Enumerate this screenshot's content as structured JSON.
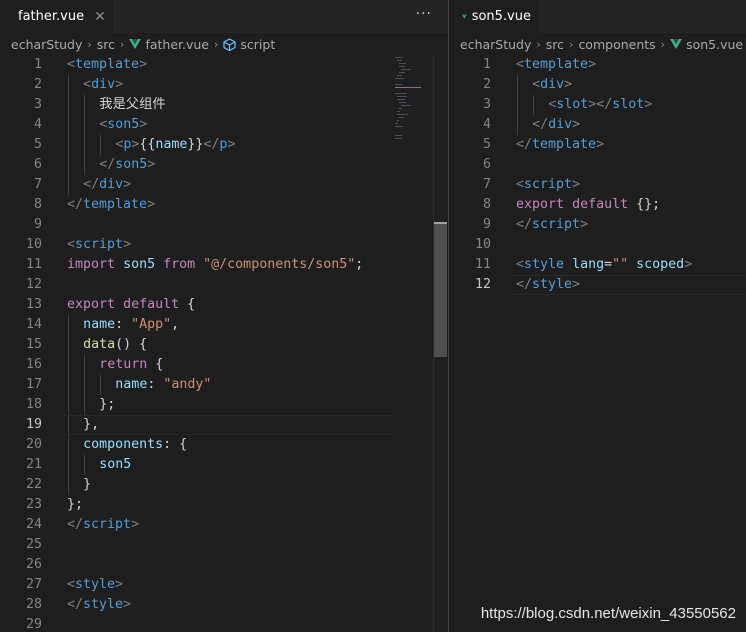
{
  "left_pane": {
    "tab": {
      "label": "father.vue",
      "close": "✕"
    },
    "more": "···",
    "breadcrumb": [
      "echarStudy",
      "src",
      "father.vue",
      "script"
    ],
    "current_line": 19,
    "lines": [
      {
        "n": "1",
        "indent": 0,
        "tokens": [
          [
            "t-punct",
            "<"
          ],
          [
            "t-tag",
            "template"
          ],
          [
            "t-punct",
            ">"
          ]
        ]
      },
      {
        "n": "2",
        "indent": 1,
        "tokens": [
          [
            "t-punct",
            "<"
          ],
          [
            "t-tag",
            "div"
          ],
          [
            "t-punct",
            ">"
          ]
        ]
      },
      {
        "n": "3",
        "indent": 2,
        "tokens": [
          [
            "t-text",
            "我是父组件"
          ]
        ]
      },
      {
        "n": "4",
        "indent": 2,
        "tokens": [
          [
            "t-punct",
            "<"
          ],
          [
            "t-tag",
            "son5"
          ],
          [
            "t-punct",
            ">"
          ]
        ]
      },
      {
        "n": "5",
        "indent": 3,
        "tokens": [
          [
            "t-punct",
            "<"
          ],
          [
            "t-tag",
            "p"
          ],
          [
            "t-punct",
            ">"
          ],
          [
            "t-interp",
            "{{"
          ],
          [
            "t-var",
            "name"
          ],
          [
            "t-interp",
            "}}"
          ],
          [
            "t-punct",
            "</"
          ],
          [
            "t-tag",
            "p"
          ],
          [
            "t-punct",
            ">"
          ]
        ]
      },
      {
        "n": "6",
        "indent": 2,
        "tokens": [
          [
            "t-punct",
            "</"
          ],
          [
            "t-tag",
            "son5"
          ],
          [
            "t-punct",
            ">"
          ]
        ]
      },
      {
        "n": "7",
        "indent": 1,
        "tokens": [
          [
            "t-punct",
            "</"
          ],
          [
            "t-tag",
            "div"
          ],
          [
            "t-punct",
            ">"
          ]
        ]
      },
      {
        "n": "8",
        "indent": 0,
        "tokens": [
          [
            "t-punct",
            "</"
          ],
          [
            "t-tag",
            "template"
          ],
          [
            "t-punct",
            ">"
          ]
        ]
      },
      {
        "n": "9",
        "indent": 0,
        "tokens": []
      },
      {
        "n": "10",
        "indent": 0,
        "tokens": [
          [
            "t-punct",
            "<"
          ],
          [
            "t-tag",
            "script"
          ],
          [
            "t-punct",
            ">"
          ]
        ]
      },
      {
        "n": "11",
        "indent": 0,
        "tokens": [
          [
            "t-kw",
            "import"
          ],
          [
            "t-text",
            " "
          ],
          [
            "t-var",
            "son5"
          ],
          [
            "t-text",
            " "
          ],
          [
            "t-kw",
            "from"
          ],
          [
            "t-text",
            " "
          ],
          [
            "t-str",
            "\"@/components/son5\""
          ],
          [
            "t-text",
            ";"
          ]
        ]
      },
      {
        "n": "12",
        "indent": 0,
        "tokens": []
      },
      {
        "n": "13",
        "indent": 0,
        "tokens": [
          [
            "t-kw",
            "export"
          ],
          [
            "t-text",
            " "
          ],
          [
            "t-kw",
            "default"
          ],
          [
            "t-text",
            " {"
          ]
        ]
      },
      {
        "n": "14",
        "indent": 1,
        "tokens": [
          [
            "t-var",
            "name"
          ],
          [
            "t-text",
            ": "
          ],
          [
            "t-str",
            "\"App\""
          ],
          [
            "t-text",
            ","
          ]
        ]
      },
      {
        "n": "15",
        "indent": 1,
        "tokens": [
          [
            "t-fn",
            "data"
          ],
          [
            "t-text",
            "() {"
          ]
        ]
      },
      {
        "n": "16",
        "indent": 2,
        "tokens": [
          [
            "t-kw",
            "return"
          ],
          [
            "t-text",
            " {"
          ]
        ]
      },
      {
        "n": "17",
        "indent": 3,
        "tokens": [
          [
            "t-var",
            "name"
          ],
          [
            "t-text",
            ": "
          ],
          [
            "t-str",
            "\"andy\""
          ]
        ]
      },
      {
        "n": "18",
        "indent": 2,
        "tokens": [
          [
            "t-text",
            "};"
          ]
        ]
      },
      {
        "n": "19",
        "indent": 1,
        "tokens": [
          [
            "t-text",
            "},"
          ]
        ]
      },
      {
        "n": "20",
        "indent": 1,
        "tokens": [
          [
            "t-var",
            "components"
          ],
          [
            "t-text",
            ": {"
          ]
        ]
      },
      {
        "n": "21",
        "indent": 2,
        "tokens": [
          [
            "t-var",
            "son5"
          ]
        ]
      },
      {
        "n": "22",
        "indent": 1,
        "tokens": [
          [
            "t-text",
            "}"
          ]
        ]
      },
      {
        "n": "23",
        "indent": 0,
        "tokens": [
          [
            "t-text",
            "};"
          ]
        ]
      },
      {
        "n": "24",
        "indent": 0,
        "tokens": [
          [
            "t-punct",
            "</"
          ],
          [
            "t-tag",
            "script"
          ],
          [
            "t-punct",
            ">"
          ]
        ]
      },
      {
        "n": "25",
        "indent": 0,
        "tokens": []
      },
      {
        "n": "26",
        "indent": 0,
        "tokens": []
      },
      {
        "n": "27",
        "indent": 0,
        "tokens": [
          [
            "t-punct",
            "<"
          ],
          [
            "t-tag",
            "style"
          ],
          [
            "t-punct",
            ">"
          ]
        ]
      },
      {
        "n": "28",
        "indent": 0,
        "tokens": [
          [
            "t-punct",
            "</"
          ],
          [
            "t-tag",
            "style"
          ],
          [
            "t-punct",
            ">"
          ]
        ]
      },
      {
        "n": "29",
        "indent": 0,
        "tokens": []
      }
    ]
  },
  "right_pane": {
    "tab": {
      "label": "son5.vue"
    },
    "breadcrumb": [
      "echarStudy",
      "src",
      "components",
      "son5.vue"
    ],
    "current_line": 12,
    "lines": [
      {
        "n": "1",
        "indent": 0,
        "tokens": [
          [
            "t-punct",
            "<"
          ],
          [
            "t-tag",
            "template"
          ],
          [
            "t-punct",
            ">"
          ]
        ]
      },
      {
        "n": "2",
        "indent": 1,
        "tokens": [
          [
            "t-punct",
            "<"
          ],
          [
            "t-tag",
            "div"
          ],
          [
            "t-punct",
            ">"
          ]
        ]
      },
      {
        "n": "3",
        "indent": 2,
        "tokens": [
          [
            "t-punct",
            "<"
          ],
          [
            "t-tag",
            "slot"
          ],
          [
            "t-punct",
            "></"
          ],
          [
            "t-tag",
            "slot"
          ],
          [
            "t-punct",
            ">"
          ]
        ]
      },
      {
        "n": "4",
        "indent": 1,
        "tokens": [
          [
            "t-punct",
            "</"
          ],
          [
            "t-tag",
            "div"
          ],
          [
            "t-punct",
            ">"
          ]
        ]
      },
      {
        "n": "5",
        "indent": 0,
        "tokens": [
          [
            "t-punct",
            "</"
          ],
          [
            "t-tag",
            "template"
          ],
          [
            "t-punct",
            ">"
          ]
        ]
      },
      {
        "n": "6",
        "indent": 0,
        "tokens": []
      },
      {
        "n": "7",
        "indent": 0,
        "tokens": [
          [
            "t-punct",
            "<"
          ],
          [
            "t-tag",
            "script"
          ],
          [
            "t-punct",
            ">"
          ]
        ]
      },
      {
        "n": "8",
        "indent": 0,
        "tokens": [
          [
            "t-kw",
            "export"
          ],
          [
            "t-text",
            " "
          ],
          [
            "t-kw",
            "default"
          ],
          [
            "t-text",
            " {};"
          ]
        ]
      },
      {
        "n": "9",
        "indent": 0,
        "tokens": [
          [
            "t-punct",
            "</"
          ],
          [
            "t-tag",
            "script"
          ],
          [
            "t-punct",
            ">"
          ]
        ]
      },
      {
        "n": "10",
        "indent": 0,
        "tokens": []
      },
      {
        "n": "11",
        "indent": 0,
        "tokens": [
          [
            "t-punct",
            "<"
          ],
          [
            "t-tag",
            "style"
          ],
          [
            "t-text",
            " "
          ],
          [
            "t-attr",
            "lang"
          ],
          [
            "t-text",
            "="
          ],
          [
            "t-str",
            "\"\""
          ],
          [
            "t-text",
            " "
          ],
          [
            "t-attr",
            "scoped"
          ],
          [
            "t-punct",
            ">"
          ]
        ]
      },
      {
        "n": "12",
        "indent": 0,
        "tokens": [
          [
            "t-punct",
            "</"
          ],
          [
            "t-tag",
            "style"
          ],
          [
            "t-punct",
            ">"
          ]
        ]
      }
    ]
  },
  "watermark": "https://blog.csdn.net/weixin_43550562",
  "colors": {
    "background": "#1e1e1e",
    "tag": "#569cd6",
    "keyword": "#c586c0",
    "string": "#ce9178",
    "variable": "#9cdcfe",
    "function": "#dcdcaa",
    "vue_green": "#41b883"
  }
}
